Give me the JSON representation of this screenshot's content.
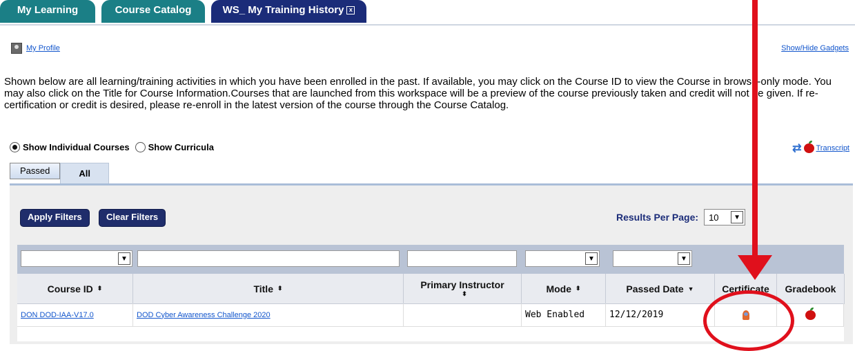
{
  "tabs": [
    {
      "label": "My Learning"
    },
    {
      "label": "Course Catalog"
    },
    {
      "label": "WS_ My Training History"
    }
  ],
  "tab_close_glyph": "x",
  "links": {
    "my_profile": "My Profile",
    "show_hide": "Show/Hide Gadgets",
    "transcript": "Transcript"
  },
  "intro": "Shown below are all learning/training activities in which you have been enrolled in the past. If available, you may click on the Course ID to view the Course in browse-only mode. You may also click on the Title for Course Information.Courses that are launched from this workspace will be a preview of the course previously taken and credit will not be given. If re-certification or credit is desired, please re-enroll in the latest version of the course through the Course Catalog.",
  "view_options": {
    "individual": "Show Individual Courses",
    "curricula": "Show Curricula"
  },
  "subtabs": {
    "passed": "Passed",
    "all": "All"
  },
  "buttons": {
    "apply": "Apply Filters",
    "clear": "Clear Filters"
  },
  "results_per_page": {
    "label": "Results Per Page:",
    "value": "10"
  },
  "columns": {
    "course_id": "Course ID",
    "title": "Title",
    "instructor": "Primary Instructor",
    "mode": "Mode",
    "passed_date": "Passed Date",
    "certificate": "Certificate",
    "gradebook": "Gradebook"
  },
  "sort_glyphs": {
    "both": "⬍",
    "down": "▼"
  },
  "row": {
    "course_id": "DON DOD-IAA-V17.0",
    "title": "DOD Cyber Awareness Challenge 2020",
    "instructor": "",
    "mode": "Web Enabled",
    "passed_date": "12/12/2019"
  },
  "icons": {
    "profile": "profile-icon",
    "refresh": "refresh-icon",
    "transcript": "apple-icon",
    "certificate": "certificate-ribbon-icon",
    "gradebook": "apple-icon"
  },
  "colors": {
    "tab_green": "#1b7f86",
    "tab_active": "#1b2c79",
    "annotation_red": "#e0101c"
  }
}
